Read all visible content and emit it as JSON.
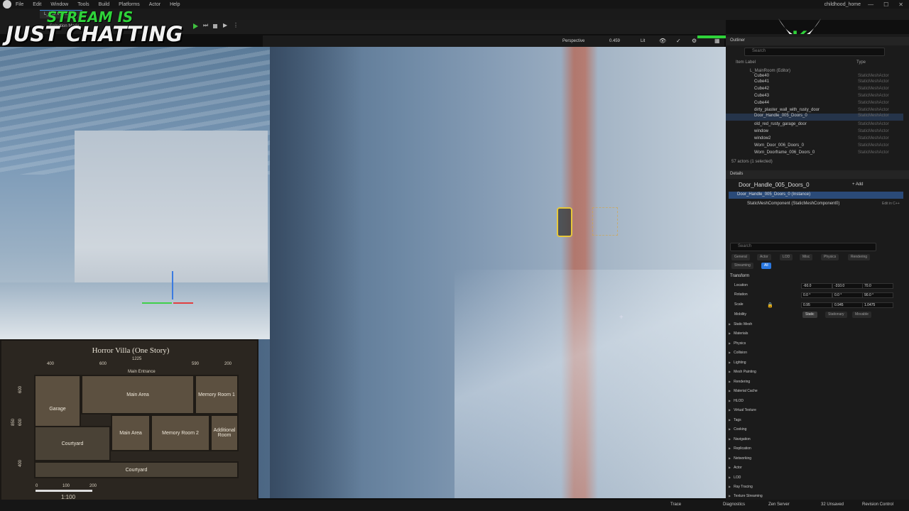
{
  "menu": {
    "items": [
      "File",
      "Edit",
      "Window",
      "Tools",
      "Build",
      "Platforms",
      "Actor",
      "Help"
    ],
    "project": "childhood_home"
  },
  "window_controls": [
    "—",
    "☐",
    "✕"
  ],
  "tab": {
    "label": "L_MainRoom"
  },
  "toolbar": {
    "mode": "Selection Mode"
  },
  "overlay": {
    "line1": "STREAM IS",
    "line2": "JUST CHATTING"
  },
  "viewport_toolbar": {
    "perspective": "Perspective",
    "fov": "0.459",
    "lit": "Lit"
  },
  "map": {
    "title": "Horror Villa (One Story)",
    "dims_top": [
      "400",
      "1225",
      "600",
      "590",
      "200"
    ],
    "dims_left": [
      "600",
      "850",
      "600",
      "400"
    ],
    "entrance": "Main Entrance",
    "rooms": [
      "Garage",
      "Main Area",
      "Memory Room 1",
      "Main Area",
      "Memory Room 2",
      "Additional Room",
      "Courtyard",
      "Courtyard"
    ],
    "scale_ticks": [
      "0",
      "100",
      "200"
    ],
    "scale": "1:100"
  },
  "outliner": {
    "title": "Outliner",
    "search_placeholder": "Search",
    "col_label": "Item Label",
    "col_type": "Type",
    "root": "L_MainRoom (Editor)",
    "rows": [
      {
        "name": "Cube40",
        "type": "StaticMeshActor"
      },
      {
        "name": "Cube41",
        "type": "StaticMeshActor"
      },
      {
        "name": "Cube42",
        "type": "StaticMeshActor"
      },
      {
        "name": "Cube43",
        "type": "StaticMeshActor"
      },
      {
        "name": "Cube44",
        "type": "StaticMeshActor"
      },
      {
        "name": "dirty_plaster_wall_with_rusty_door",
        "type": "StaticMeshActor"
      },
      {
        "name": "Door_Handle_005_Doors_0",
        "type": "StaticMeshActor"
      },
      {
        "name": "old_red_rusty_garage_door",
        "type": "StaticMeshActor"
      },
      {
        "name": "window",
        "type": "StaticMeshActor"
      },
      {
        "name": "window2",
        "type": "StaticMeshActor"
      },
      {
        "name": "Worn_Door_006_Doors_0",
        "type": "StaticMeshActor"
      },
      {
        "name": "Worn_Doorframe_006_Doors_0",
        "type": "StaticMeshActor"
      }
    ],
    "count": "57 actors (1 selected)"
  },
  "details": {
    "title": "Details",
    "actor": "Door_Handle_005_Doors_0",
    "add_label": "+ Add",
    "instance": "Door_Handle_005_Doors_0 (Instance)",
    "component": "StaticMeshComponent (StaticMeshComponent0)",
    "edit_link": "Edit in C++",
    "search_placeholder": "Search",
    "filters": [
      "General",
      "Actor",
      "LOD",
      "Misc",
      "Physics",
      "Rendering",
      "Streaming",
      "All"
    ],
    "transform": "Transform",
    "location": {
      "label": "Location",
      "x": "-60.0",
      "y": "-310.0",
      "z": "70.0"
    },
    "rotation": {
      "label": "Rotation",
      "x": "0.0 °",
      "y": "0.0 °",
      "z": "90.0 °"
    },
    "scale": {
      "label": "Scale",
      "x": "0.95",
      "y": "0.945",
      "z": "1.0475"
    },
    "mobility": {
      "label": "Mobility",
      "options": [
        "Static",
        "Stationary",
        "Movable"
      ]
    },
    "categories": [
      "Static Mesh",
      "Materials",
      "Physics",
      "Collision",
      "Lighting",
      "Mesh Painting",
      "Rendering",
      "Material Cache",
      "HLOD",
      "Virtual Texture",
      "Tags",
      "Cooking",
      "Navigation",
      "Replication",
      "Networking",
      "Actor",
      "LOD",
      "Ray Tracing",
      "Texture Streaming"
    ]
  },
  "status": {
    "trace": "Trace",
    "diagnostics": "Diagnostics",
    "zen": "Zen Server",
    "unsaved": "32 Unsaved",
    "revision": "Revision Control"
  },
  "colors": {
    "accent": "#2a78e0",
    "overlay_green": "#2fd33a",
    "selection": "#e8c83a"
  }
}
